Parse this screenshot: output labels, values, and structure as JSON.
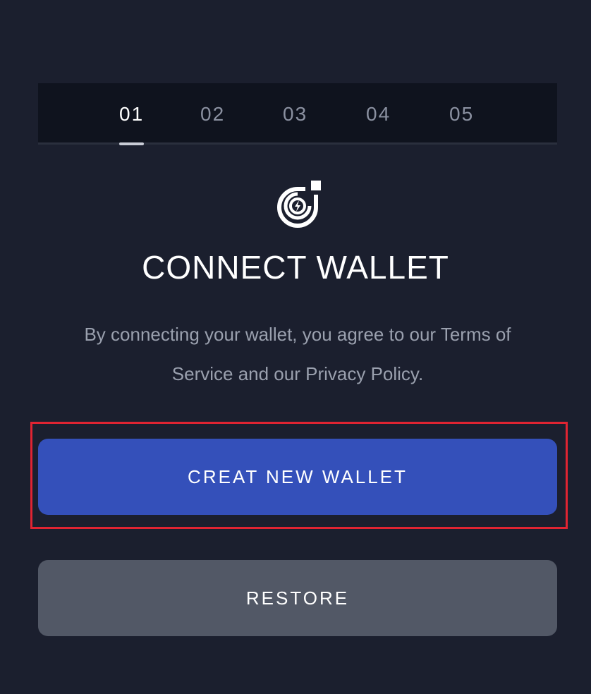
{
  "steps": {
    "items": [
      "01",
      "02",
      "03",
      "04",
      "05"
    ],
    "active_index": 0
  },
  "logo": {
    "icon": "lightning-ring-logo-icon"
  },
  "title": "CONNECT WALLET",
  "description": "By connecting your wallet, you agree to our Terms of Service and our Privacy Policy.",
  "buttons": {
    "create_label": "CREAT NEW WALLET",
    "restore_label": "RESTORE"
  },
  "colors": {
    "background": "#1b1f2e",
    "primary_button": "#3450ba",
    "secondary_button": "#525866",
    "highlight": "#e02432"
  }
}
